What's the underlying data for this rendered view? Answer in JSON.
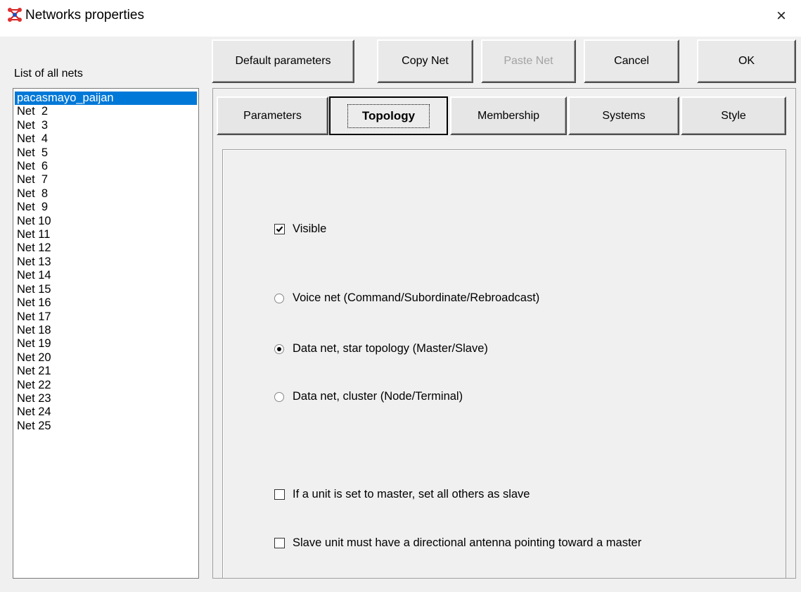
{
  "window": {
    "title": "Networks properties",
    "close_glyph": "×",
    "icon": "network-app-icon"
  },
  "nets_list": {
    "label": "List of all nets",
    "selected_index": 0,
    "items": [
      "pacasmayo_paijan",
      "Net  2",
      "Net  3",
      "Net  4",
      "Net  5",
      "Net  6",
      "Net  7",
      "Net  8",
      "Net  9",
      "Net 10",
      "Net 11",
      "Net 12",
      "Net 13",
      "Net 14",
      "Net 15",
      "Net 16",
      "Net 17",
      "Net 18",
      "Net 19",
      "Net 20",
      "Net 21",
      "Net 22",
      "Net 23",
      "Net 24",
      "Net 25"
    ]
  },
  "toolbar": {
    "default_parameters": "Default parameters",
    "copy_net": "Copy Net",
    "paste_net": "Paste Net",
    "paste_net_enabled": false,
    "cancel": "Cancel",
    "ok": "OK"
  },
  "tabs": {
    "active": "Topology",
    "items": [
      "Parameters",
      "Topology",
      "Membership",
      "Systems",
      "Style"
    ]
  },
  "topology": {
    "visible_label": "Visible",
    "visible_checked": true,
    "net_type_options": [
      "Voice net (Command/Subordinate/Rebroadcast)",
      "Data net, star topology (Master/Slave)",
      "Data net, cluster (Node/Terminal)"
    ],
    "net_type_selected": 1,
    "master_option_label": "If a unit is set to master, set all others as slave",
    "master_option_checked": false,
    "antenna_option_label": "Slave unit must have a directional antenna pointing toward a master",
    "antenna_option_checked": false
  },
  "colors": {
    "selection": "#0078d7",
    "window_bg": "#f0f0f0",
    "disabled_text": "#a3a3a3"
  }
}
